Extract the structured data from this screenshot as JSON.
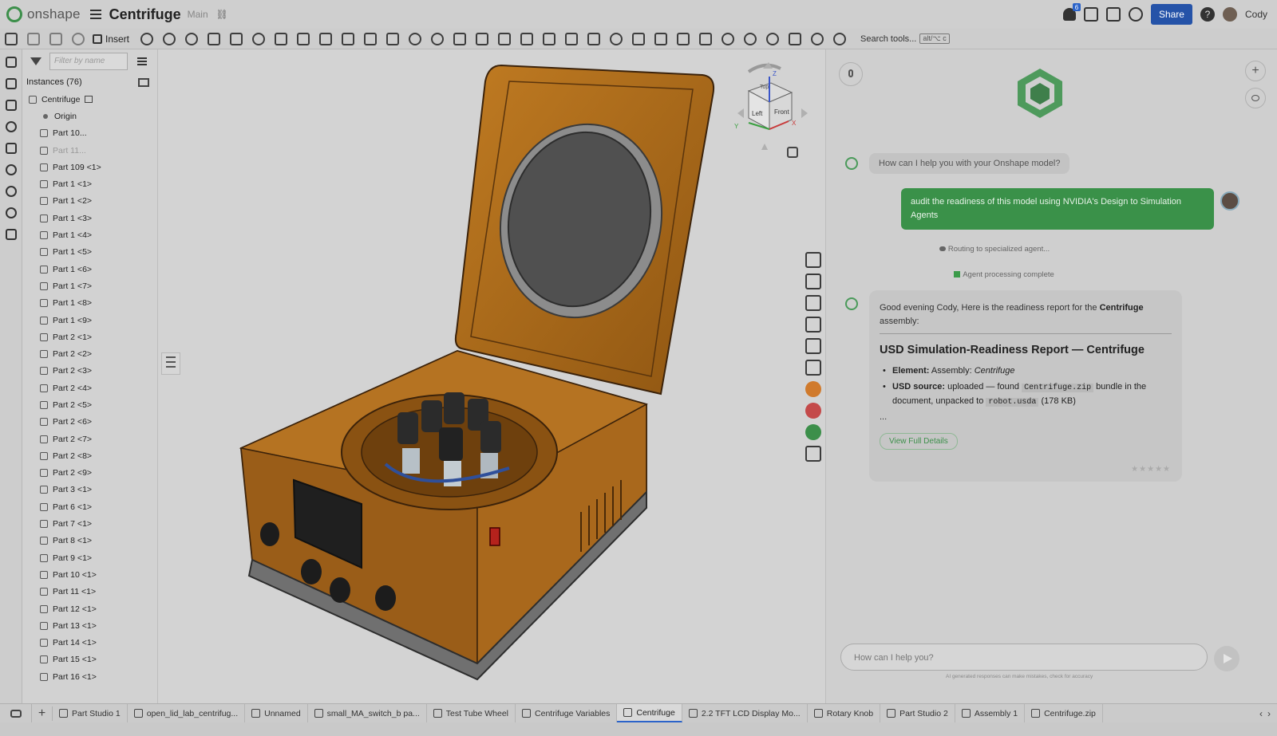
{
  "app": {
    "brand": "onshape",
    "doc_title": "Centrifuge",
    "branch": "Main",
    "share_label": "Share",
    "user_name": "Cody",
    "notification_count": "6"
  },
  "toolbar": {
    "insert_label": "Insert",
    "search_label": "Search tools...",
    "search_shortcut": "alt/⌥ c"
  },
  "tree": {
    "filter_placeholder": "Filter by name",
    "instances_label": "Instances (76)",
    "root_label": "Centrifuge",
    "origin_label": "Origin",
    "items": [
      "Part 10...",
      "Part 11...",
      "Part 109 <1>",
      "Part 1 <1>",
      "Part 1 <2>",
      "Part 1 <3>",
      "Part 1 <4>",
      "Part 1 <5>",
      "Part 1 <6>",
      "Part 1 <7>",
      "Part 1 <8>",
      "Part 1 <9>",
      "Part 2 <1>",
      "Part 2 <2>",
      "Part 2 <3>",
      "Part 2 <4>",
      "Part 2 <5>",
      "Part 2 <6>",
      "Part 2 <7>",
      "Part 2 <8>",
      "Part 2 <9>",
      "Part 3 <1>",
      "Part 6 <1>",
      "Part 7 <1>",
      "Part 8 <1>",
      "Part 9 <1>",
      "Part 10 <1>",
      "Part 11 <1>",
      "Part 12 <1>",
      "Part 13 <1>",
      "Part 14 <1>",
      "Part 15 <1>",
      "Part 16 <1>"
    ]
  },
  "viewcube": {
    "top": "Top",
    "left": "Left",
    "front": "Front",
    "axis_x": "X",
    "axis_y": "Y",
    "axis_z": "Z"
  },
  "assistant": {
    "greeting_question": "How can I help you with your Onshape model?",
    "user_message": "audit the readiness of this model using NVIDIA's Design to Simulation Agents",
    "status_routing": "Routing to specialized agent...",
    "status_complete": "Agent processing complete",
    "report": {
      "intro_prefix": "Good evening Cody, Here is the readiness report for the ",
      "intro_bold": "Centrifuge",
      "intro_suffix": " assembly:",
      "title": "USD Simulation-Readiness Report — Centrifuge",
      "element_label": "Element:",
      "element_value": "Assembly: ",
      "element_name": "Centrifuge",
      "usd_label": "USD source:",
      "usd_prefix": "uploaded — found",
      "usd_file": "Centrifuge.zip",
      "usd_mid": "bundle in the document, unpacked to",
      "usd_unpacked": "robot.usda",
      "usd_size": "(178 KB)",
      "ellipsis": "...",
      "details_label": "View Full Details",
      "stars": "★★★★★"
    },
    "input_placeholder": "How can I help you?",
    "disclaimer": "AI generated responses can make mistakes, check for accuracy"
  },
  "tabs": [
    {
      "label": "Part Studio 1",
      "active": false
    },
    {
      "label": "open_lid_lab_centrifug...",
      "active": false
    },
    {
      "label": "Unnamed",
      "active": false
    },
    {
      "label": "small_MA_switch_b pa...",
      "active": false
    },
    {
      "label": "Test Tube Wheel",
      "active": false
    },
    {
      "label": "Centrifuge Variables",
      "active": false
    },
    {
      "label": "Centrifuge",
      "active": true
    },
    {
      "label": "2.2 TFT LCD Display Mo...",
      "active": false
    },
    {
      "label": "Rotary Knob",
      "active": false
    },
    {
      "label": "Part Studio 2",
      "active": false
    },
    {
      "label": "Assembly 1",
      "active": false
    },
    {
      "label": "Centrifuge.zip",
      "active": false
    }
  ],
  "colors": {
    "brand_green": "#3c8f4a",
    "share_blue": "#2553a8",
    "model_orange": "#b5711e",
    "user_bubble": "#3a9149"
  }
}
